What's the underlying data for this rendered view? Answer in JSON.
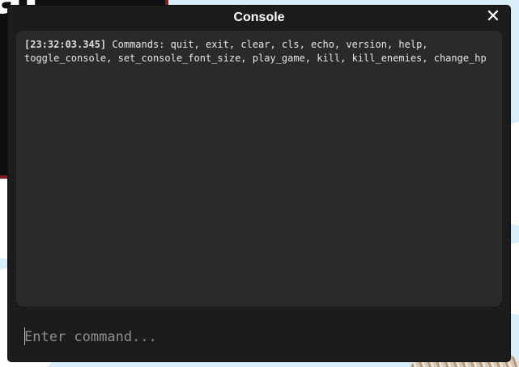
{
  "window": {
    "title": "Console",
    "close_icon": "close-icon",
    "close_glyph": "✕"
  },
  "background": {
    "logo_text": "at"
  },
  "log": {
    "entries": [
      {
        "timestamp": "[23:32:03.345]",
        "message": "Commands: quit, exit, clear, cls, echo, version, help, toggle_console, set_console_font_size, play_game, kill, kill_enemies, change_hp"
      }
    ]
  },
  "command_input": {
    "value": "",
    "placeholder": "Enter command..."
  },
  "colors": {
    "window_bg": "#1c1c1c",
    "log_bg": "#2a2a2a",
    "text": "#e6e6e6",
    "placeholder": "#8e8e8e"
  }
}
